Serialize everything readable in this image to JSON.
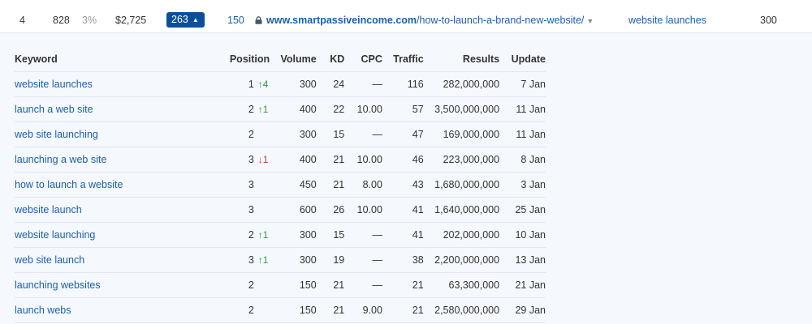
{
  "summary_row": {
    "position": "4",
    "ur": "828",
    "traffic_pct": "3%",
    "value": "$2,725",
    "keywords_count": "263",
    "referring": "150",
    "url_domain": "www.smartpassiveincome.com",
    "url_path": "/how-to-launch-a-brand-new-website/",
    "top_keyword": "website launches",
    "top_keyword_volume": "300"
  },
  "table": {
    "headers": {
      "keyword": "Keyword",
      "position": "Position",
      "volume": "Volume",
      "kd": "KD",
      "cpc": "CPC",
      "traffic": "Traffic",
      "results": "Results",
      "update": "Update"
    },
    "rows": [
      {
        "keyword": "website launches",
        "position": "1",
        "change": "↑4",
        "change_dir": "up",
        "volume": "300",
        "kd": "24",
        "cpc": "—",
        "traffic": "116",
        "results": "282,000,000",
        "update": "7 Jan"
      },
      {
        "keyword": "launch a web site",
        "position": "2",
        "change": "↑1",
        "change_dir": "up",
        "volume": "400",
        "kd": "22",
        "cpc": "10.00",
        "traffic": "57",
        "results": "3,500,000,000",
        "update": "11 Jan"
      },
      {
        "keyword": "web site launching",
        "position": "2",
        "change": "",
        "change_dir": "",
        "volume": "300",
        "kd": "15",
        "cpc": "—",
        "traffic": "47",
        "results": "169,000,000",
        "update": "11 Jan"
      },
      {
        "keyword": "launching a web site",
        "position": "3",
        "change": "↓1",
        "change_dir": "down",
        "volume": "400",
        "kd": "21",
        "cpc": "10.00",
        "traffic": "46",
        "results": "223,000,000",
        "update": "8 Jan"
      },
      {
        "keyword": "how to launch a website",
        "position": "3",
        "change": "",
        "change_dir": "",
        "volume": "450",
        "kd": "21",
        "cpc": "8.00",
        "traffic": "43",
        "results": "1,680,000,000",
        "update": "3 Jan"
      },
      {
        "keyword": "website launch",
        "position": "3",
        "change": "",
        "change_dir": "",
        "volume": "600",
        "kd": "26",
        "cpc": "10.00",
        "traffic": "41",
        "results": "1,640,000,000",
        "update": "25 Jan"
      },
      {
        "keyword": "website launching",
        "position": "2",
        "change": "↑1",
        "change_dir": "up",
        "volume": "300",
        "kd": "15",
        "cpc": "—",
        "traffic": "41",
        "results": "202,000,000",
        "update": "10 Jan"
      },
      {
        "keyword": "web site launch",
        "position": "3",
        "change": "↑1",
        "change_dir": "up",
        "volume": "300",
        "kd": "19",
        "cpc": "—",
        "traffic": "38",
        "results": "2,200,000,000",
        "update": "13 Jan"
      },
      {
        "keyword": "launching websites",
        "position": "2",
        "change": "",
        "change_dir": "",
        "volume": "150",
        "kd": "21",
        "cpc": "—",
        "traffic": "21",
        "results": "63,300,000",
        "update": "21 Jan"
      },
      {
        "keyword": "launch webs",
        "position": "2",
        "change": "",
        "change_dir": "",
        "volume": "150",
        "kd": "21",
        "cpc": "9.00",
        "traffic": "21",
        "results": "2,580,000,000",
        "update": "29 Jan"
      }
    ]
  },
  "colors": {
    "link": "#1a5fae",
    "badge_bg": "#0b4f9c",
    "up": "#2ea043",
    "down": "#c0392b",
    "expanded_bg": "#f5f8fc"
  },
  "icons": {
    "lock": "lock-icon",
    "dropdown": "chevron-down-icon",
    "expand": "triangle-up-icon"
  }
}
